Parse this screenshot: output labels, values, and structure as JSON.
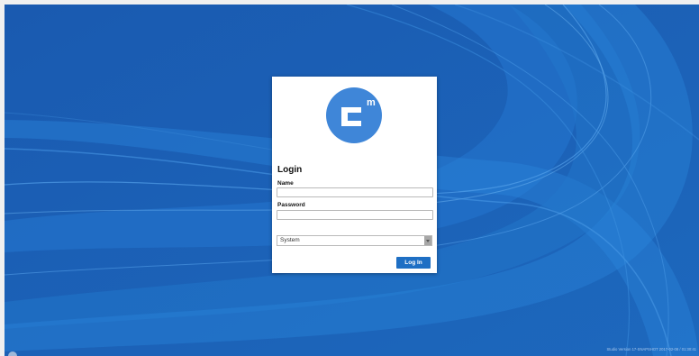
{
  "login": {
    "title": "Login",
    "name_label": "Name",
    "name_value": "",
    "password_label": "Password",
    "password_value": "",
    "domain_selected": "System",
    "login_button": "Log In"
  },
  "footer": {
    "version": "Studio Version 17-SNAPSHOT 2017-02-08 / 01:30:41"
  },
  "colors": {
    "background": "#1a5fb0",
    "logo": "#3f86d8",
    "button": "#1e6fc4"
  },
  "icons": {
    "logo": "cm-logo-icon",
    "select_arrow": "chevron-down-icon"
  }
}
